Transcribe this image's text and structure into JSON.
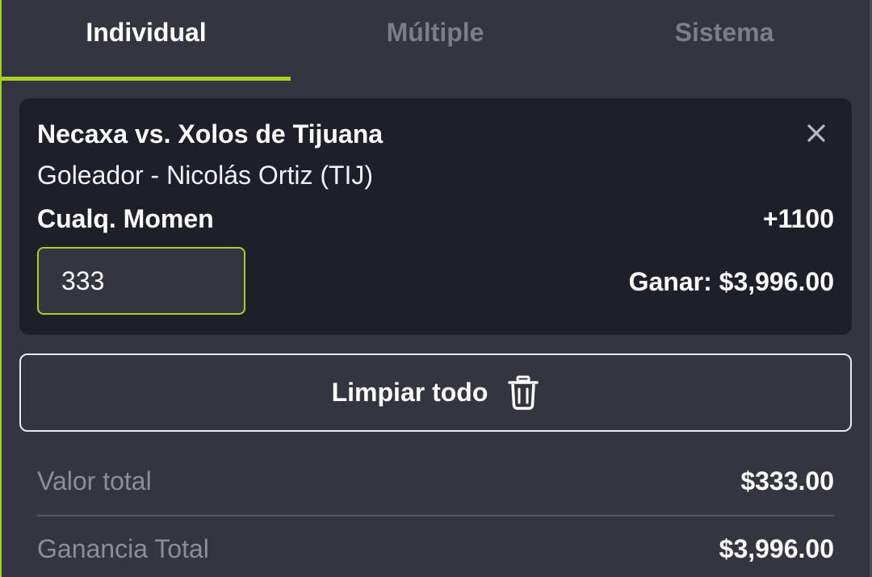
{
  "tabs": [
    {
      "label": "Individual",
      "active": true
    },
    {
      "label": "Múltiple",
      "active": false
    },
    {
      "label": "Sistema",
      "active": false
    }
  ],
  "bet": {
    "match": "Necaxa vs. Xolos de Tijuana",
    "selection": "Goleador - Nicolás Ortiz (TIJ)",
    "market": "Cualq. Momen",
    "odds": "+1100",
    "stake": "333",
    "win_text": "Ganar: $3,996.00",
    "close_icon": "close-icon"
  },
  "clear_all": {
    "label": "Limpiar todo",
    "icon": "trash-icon"
  },
  "summary": {
    "total_label": "Valor total",
    "total_value": "$333.00",
    "gain_label": "Ganancia Total",
    "gain_value": "$3,996.00"
  },
  "colors": {
    "accent": "#a5d21e",
    "background": "#353541",
    "card": "#1f1f29",
    "muted_text": "#8d8d98"
  }
}
